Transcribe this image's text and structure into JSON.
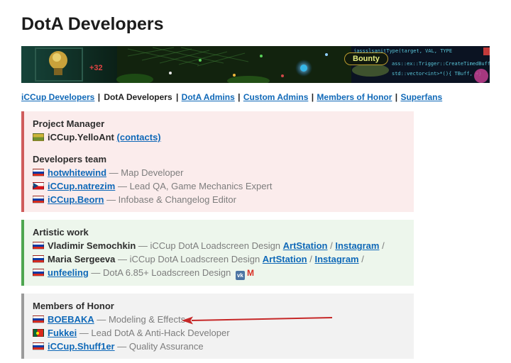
{
  "page": {
    "title": "DotA Developers"
  },
  "banner": {
    "bounty_label": "Bounty",
    "overlay_value": "+32",
    "code_lines": [
      "jassslsanitType(target, VAL, TYPE",
      "ass::ex::Trigger::CreateTimedBuffP",
      "std::vector<int>*(){ TBuff, +}"
    ]
  },
  "nav": {
    "separator": " | ",
    "items": [
      {
        "label": "iCCup Developers",
        "link": true
      },
      {
        "label": "DotA Developers",
        "link": false
      },
      {
        "label": "DotA Admins",
        "link": true
      },
      {
        "label": "Custom Admins",
        "link": true
      },
      {
        "label": "Members of Honor",
        "link": true
      },
      {
        "label": "Superfans",
        "link": true
      }
    ]
  },
  "sections": [
    {
      "id": "project-manager",
      "theme": "red",
      "groups": [
        {
          "heading": "Project Manager",
          "rows": [
            {
              "segments": [
                {
                  "type": "flag",
                  "country": "ukraine"
                },
                {
                  "type": "name",
                  "text": "iCCup.YelloAnt"
                },
                {
                  "type": "plain",
                  "text": " "
                },
                {
                  "type": "link",
                  "text": "(contacts)"
                }
              ]
            }
          ]
        },
        {
          "heading": "Developers team",
          "rows": [
            {
              "segments": [
                {
                  "type": "flag",
                  "country": "russia"
                },
                {
                  "type": "link",
                  "text": "hotwhitewind"
                },
                {
                  "type": "muted",
                  "text": " — Map Developer"
                }
              ]
            },
            {
              "segments": [
                {
                  "type": "flag",
                  "country": "czech"
                },
                {
                  "type": "link",
                  "text": "iCCup.natrezim"
                },
                {
                  "type": "muted",
                  "text": " — Lead QA, Game Mechanics Expert"
                }
              ]
            },
            {
              "segments": [
                {
                  "type": "flag",
                  "country": "russia"
                },
                {
                  "type": "link",
                  "text": "iCCup.Beorn"
                },
                {
                  "type": "muted",
                  "text": " — Infobase & Changelog Editor"
                }
              ]
            }
          ]
        }
      ]
    },
    {
      "id": "artistic-work",
      "theme": "green",
      "groups": [
        {
          "heading": "Artistic work",
          "rows": [
            {
              "segments": [
                {
                  "type": "flag",
                  "country": "russia"
                },
                {
                  "type": "name",
                  "text": "Vladimir Semochkin"
                },
                {
                  "type": "muted",
                  "text": " — iCCup DotA Loadscreen Design  "
                },
                {
                  "type": "link",
                  "text": "ArtStation"
                },
                {
                  "type": "muted",
                  "text": " / "
                },
                {
                  "type": "link",
                  "text": "Instagram"
                },
                {
                  "type": "muted",
                  "text": " /"
                }
              ]
            },
            {
              "segments": [
                {
                  "type": "flag",
                  "country": "russia"
                },
                {
                  "type": "name",
                  "text": "Maria Sergeeva"
                },
                {
                  "type": "muted",
                  "text": " — iCCup DotA Loadscreen Design "
                },
                {
                  "type": "link",
                  "text": "ArtStation"
                },
                {
                  "type": "muted",
                  "text": " / "
                },
                {
                  "type": "link",
                  "text": "Instagram"
                },
                {
                  "type": "muted",
                  "text": " /"
                }
              ]
            },
            {
              "segments": [
                {
                  "type": "flag",
                  "country": "russia"
                },
                {
                  "type": "link",
                  "text": "unfeeling"
                },
                {
                  "type": "muted",
                  "text": " — DotA 6.85+ Loadscreen Design "
                },
                {
                  "type": "icon",
                  "icon": "vk"
                },
                {
                  "type": "icon",
                  "icon": "gmail"
                }
              ]
            }
          ]
        }
      ]
    },
    {
      "id": "members-of-honor",
      "theme": "gray",
      "groups": [
        {
          "heading": "Members of Honor",
          "rows": [
            {
              "annotated": true,
              "segments": [
                {
                  "type": "flag",
                  "country": "russia"
                },
                {
                  "type": "link",
                  "text": "BOEBAKA"
                },
                {
                  "type": "muted",
                  "text": " — Modeling & Effects"
                }
              ]
            },
            {
              "segments": [
                {
                  "type": "flag",
                  "country": "portugal"
                },
                {
                  "type": "link",
                  "text": "Fukkei"
                },
                {
                  "type": "muted",
                  "text": " — Lead DotA & Anti-Hack Developer"
                }
              ]
            },
            {
              "segments": [
                {
                  "type": "flag",
                  "country": "russia"
                },
                {
                  "type": "link",
                  "text": "iCCup.Shuff1er"
                },
                {
                  "type": "muted",
                  "text": " — Quality Assurance"
                }
              ]
            }
          ]
        }
      ]
    }
  ]
}
